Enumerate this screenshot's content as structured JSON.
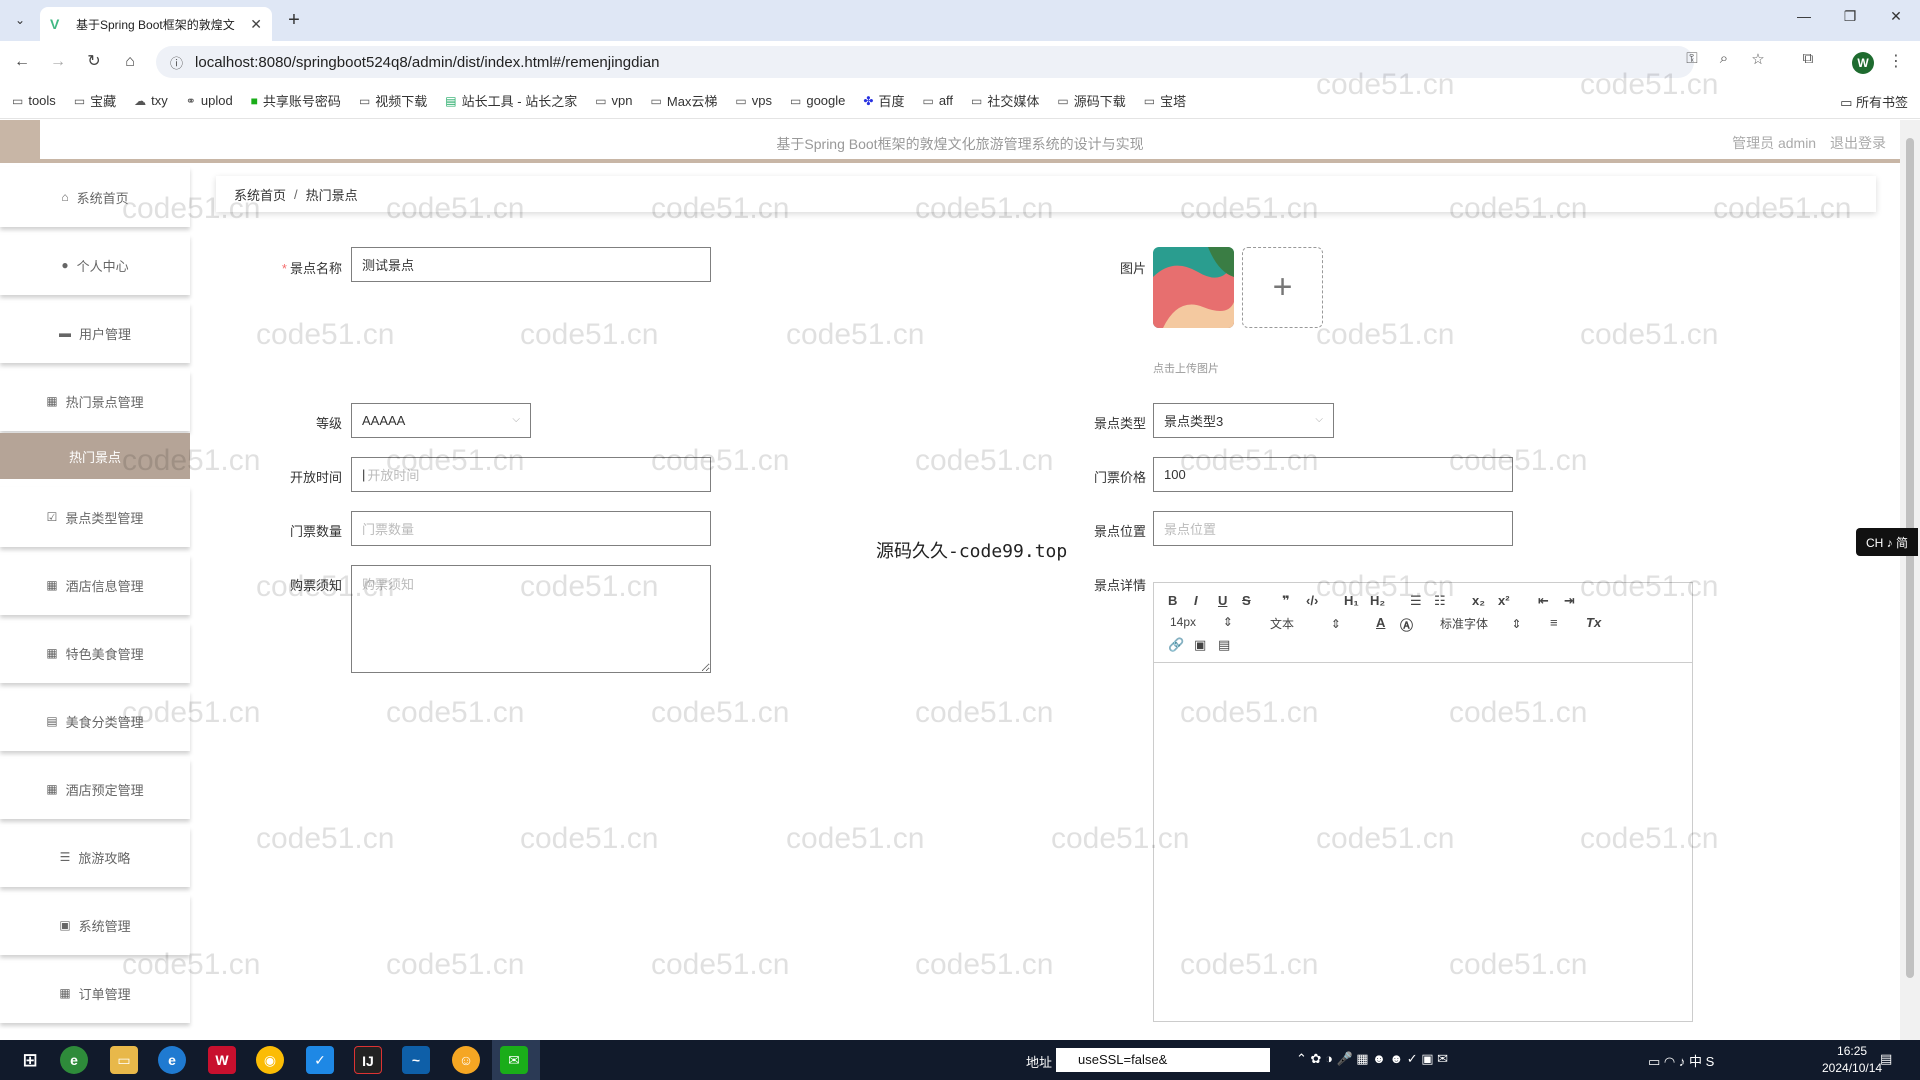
{
  "browser": {
    "tab_title": "基于Spring Boot框架的敦煌文",
    "url": "localhost:8080/springboot524q8/admin/dist/index.html#/remenjingdian",
    "profile_initial": "W",
    "bookmarks": [
      "tools",
      "宝藏",
      "txy",
      "uplod",
      "共享账号密码",
      "视频下载",
      "站长工具 - 站长之家",
      "vpn",
      "Max云梯",
      "vps",
      "google",
      "百度",
      "aff",
      "社交媒体",
      "源码下载",
      "宝塔"
    ],
    "bookmarks_right": "所有书签"
  },
  "header": {
    "system_name": "基于Spring Boot框架的敦煌文化旅游管理系统的设计与实现",
    "user_label": "管理员 admin",
    "logout": "退出登录"
  },
  "sidebar": {
    "items": [
      {
        "label": "系统首页",
        "icon": "home-icon"
      },
      {
        "label": "个人中心",
        "icon": "user-icon"
      },
      {
        "label": "用户管理",
        "icon": "users-icon"
      },
      {
        "label": "热门景点管理",
        "icon": "grid-icon"
      },
      {
        "label": "热门景点",
        "icon": ""
      },
      {
        "label": "景点类型管理",
        "icon": "checkbox-icon"
      },
      {
        "label": "酒店信息管理",
        "icon": "grid-icon"
      },
      {
        "label": "特色美食管理",
        "icon": "grid-icon"
      },
      {
        "label": "美食分类管理",
        "icon": "doc-icon"
      },
      {
        "label": "酒店预定管理",
        "icon": "grid-icon"
      },
      {
        "label": "旅游攻略",
        "icon": "list-icon"
      },
      {
        "label": "系统管理",
        "icon": "clipboard-icon"
      },
      {
        "label": "订单管理",
        "icon": "grid-icon"
      }
    ]
  },
  "breadcrumb": {
    "home": "系统首页",
    "current": "热门景点"
  },
  "form": {
    "name_label": "景点名称",
    "name_value": "测试景点",
    "image_label": "图片",
    "upload_hint": "点击上传图片",
    "level_label": "等级",
    "level_value": "AAAAA",
    "type_label": "景点类型",
    "type_value": "景点类型3",
    "open_time_label": "开放时间",
    "open_time_placeholder": "开放时间",
    "price_label": "门票价格",
    "price_value": "100",
    "qty_label": "门票数量",
    "qty_placeholder": "门票数量",
    "location_label": "景点位置",
    "location_placeholder": "景点位置",
    "notice_label": "购票须知",
    "notice_placeholder": "购票须知",
    "detail_label": "景点详情"
  },
  "editor": {
    "font_size": "14px",
    "header_select": "文本",
    "font_family": "标准字体"
  },
  "watermark": {
    "text": "code51.cn",
    "center_text": "源码久久-code99.top"
  },
  "ime": "CH ♪ 简",
  "taskbar": {
    "address_label": "地址",
    "address_value": "useSSL=false&",
    "time": "16:25",
    "date": "2024/10/14"
  }
}
